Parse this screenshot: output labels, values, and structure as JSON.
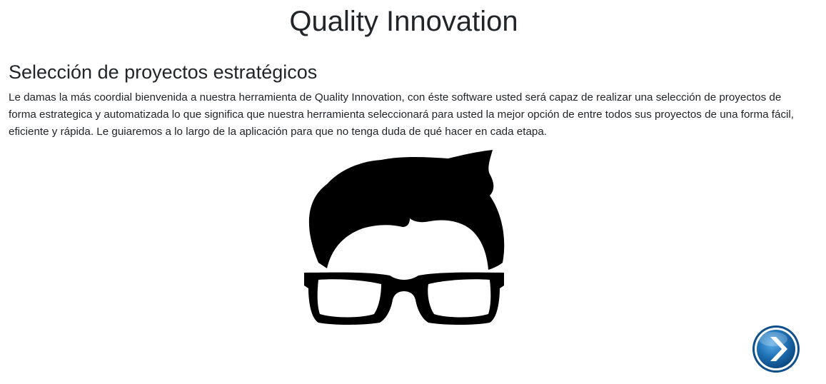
{
  "header": {
    "title": "Quality Innovation"
  },
  "main": {
    "section_title": "Selección de proyectos estratégicos",
    "intro_text": "Le damas la más coordial bienvenida a nuestra herramienta de Quality Innovation, con éste software usted será capaz de realizar una selección de proyectos de forma estrategica y automatizada lo que significa que nuestra herramienta seleccionará para usted la mejor opción de entre todos sus proyectos de una forma fácil, eficiente y rápida. Le guiaremos a lo largo de la aplicación para que no tenga duda de qué hacer en cada etapa.",
    "illustration_icon": "hair-and-glasses-face-icon"
  },
  "navigation": {
    "next_icon": "chevron-right-icon",
    "next_button_color": "#1f73b7"
  }
}
